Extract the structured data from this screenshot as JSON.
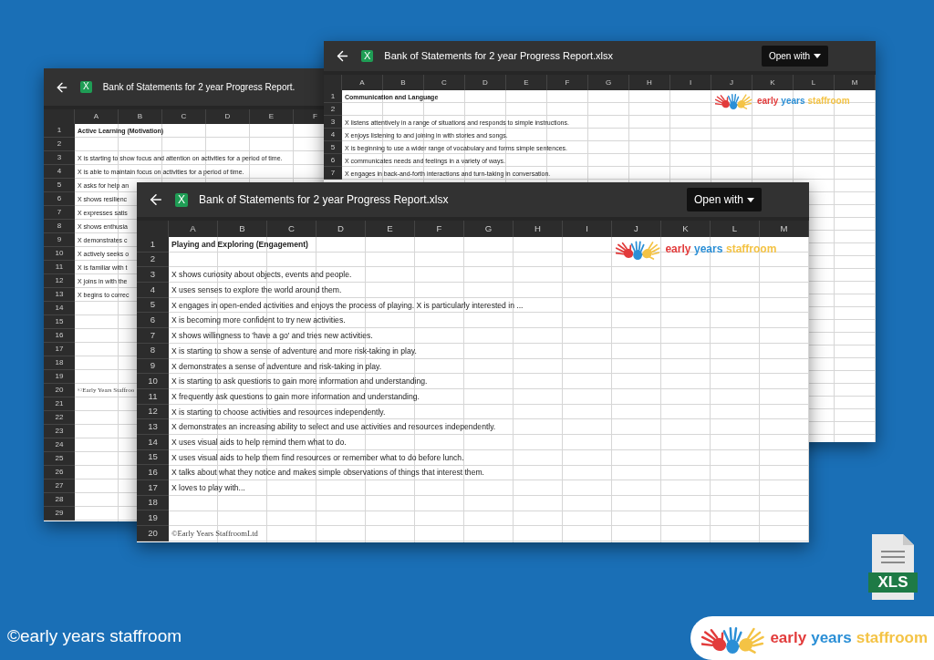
{
  "windows": [
    {
      "title": "Bank of Statements for 2 year Progress Report.xlsx",
      "badge": "X",
      "open_with": "Open with",
      "columns": [
        "A",
        "B",
        "C",
        "D",
        "E",
        "F",
        "G",
        "H",
        "I",
        "J",
        "K",
        "L",
        "M"
      ],
      "logo": {
        "words": [
          {
            "text": "early",
            "color": "#e23b3b"
          },
          {
            "text": "years",
            "color": "#2b8fd6"
          },
          {
            "text": "staffroom",
            "color": "#f4c345"
          }
        ]
      },
      "rows": [
        {
          "number": "1",
          "kind": "heading",
          "text": "Communication and Language"
        },
        {
          "number": "2"
        },
        {
          "number": "3",
          "kind": "statement",
          "text": "X listens attentively in a range of situations and responds to simple instructions."
        },
        {
          "number": "4",
          "kind": "statement",
          "text": "X enjoys listening to and joining in with stories and songs."
        },
        {
          "number": "5",
          "kind": "statement",
          "text": "X is beginning to use a wider range of vocabulary and forms simple sentences."
        },
        {
          "number": "6",
          "kind": "statement",
          "text": "X communicates needs and feelings in a variety of ways."
        },
        {
          "number": "7",
          "kind": "statement",
          "text": "X engages in back-and-forth interactions and turn-taking in conversation."
        }
      ]
    },
    {
      "title": "Bank of Statements for 2 year Progress Report.",
      "badge": "X",
      "columns": [
        "A",
        "B",
        "C",
        "D",
        "E",
        "F"
      ],
      "rows": [
        {
          "number": "1",
          "kind": "heading",
          "text": "Active Learning (Motivation)"
        },
        {
          "number": "2"
        },
        {
          "number": "3",
          "kind": "statement",
          "text": "X is starting to show focus and attention on activities for a period of time."
        },
        {
          "number": "4",
          "kind": "statement",
          "text": "X is able to maintain focus on activities for a period of time."
        },
        {
          "number": "5",
          "kind": "statement",
          "text": "X asks for help an"
        },
        {
          "number": "6",
          "kind": "statement",
          "text": "X shows resilienc"
        },
        {
          "number": "7",
          "kind": "statement",
          "text": "X expresses satis"
        },
        {
          "number": "8",
          "kind": "statement",
          "text": "X shows enthusia"
        },
        {
          "number": "9",
          "kind": "statement",
          "text": "X demonstrates c"
        },
        {
          "number": "10",
          "kind": "statement",
          "text": "X actively seeks o"
        },
        {
          "number": "11",
          "kind": "statement",
          "text": "X is familiar with t"
        },
        {
          "number": "12",
          "kind": "statement",
          "text": "X joins in with the"
        },
        {
          "number": "13",
          "kind": "statement",
          "text": "X begins to correc"
        },
        {
          "number": "14"
        },
        {
          "number": "15"
        },
        {
          "number": "16"
        },
        {
          "number": "17"
        },
        {
          "number": "18"
        },
        {
          "number": "19"
        },
        {
          "number": "20",
          "kind": "copyright",
          "text": "©Early Years Staffroo"
        },
        {
          "number": "21"
        },
        {
          "number": "22"
        },
        {
          "number": "23"
        },
        {
          "number": "24"
        },
        {
          "number": "25"
        },
        {
          "number": "26"
        },
        {
          "number": "27"
        },
        {
          "number": "28"
        },
        {
          "number": "29"
        }
      ]
    },
    {
      "title": "Bank of Statements for 2 year Progress Report.xlsx",
      "badge": "X",
      "open_with": "Open with",
      "columns": [
        "A",
        "B",
        "C",
        "D",
        "E",
        "F",
        "G",
        "H",
        "I",
        "J",
        "K",
        "L",
        "M"
      ],
      "logo": {
        "words": [
          {
            "text": "early",
            "color": "#e23b3b"
          },
          {
            "text": "years",
            "color": "#2b8fd6"
          },
          {
            "text": "staffroom",
            "color": "#f4c345"
          }
        ]
      },
      "rows": [
        {
          "number": "1",
          "kind": "heading",
          "text": "Playing and Exploring (Engagement)"
        },
        {
          "number": "2"
        },
        {
          "number": "3",
          "kind": "statement",
          "text": "X shows curiosity about objects, events and people."
        },
        {
          "number": "4",
          "kind": "statement",
          "text": "X uses senses to explore the world around them."
        },
        {
          "number": "5",
          "kind": "statement",
          "text": "X engages in open-ended activities and enjoys the process of playing. X is particularly interested in ..."
        },
        {
          "number": "6",
          "kind": "statement",
          "text": "X is becoming more confident to try new activities."
        },
        {
          "number": "7",
          "kind": "statement",
          "text": "X shows willingness to 'have a go' and tries new activities."
        },
        {
          "number": "8",
          "kind": "statement",
          "text": "X is starting to show a sense of adventure and more risk-taking in play."
        },
        {
          "number": "9",
          "kind": "statement",
          "text": "X demonstrates a sense of adventure and risk-taking in play."
        },
        {
          "number": "10",
          "kind": "statement",
          "text": "X is starting to ask questions to gain more information and understanding."
        },
        {
          "number": "11",
          "kind": "statement",
          "text": "X frequently ask questions to gain more information and understanding."
        },
        {
          "number": "12",
          "kind": "statement",
          "text": "X is starting to choose activities and resources independently."
        },
        {
          "number": "13",
          "kind": "statement",
          "text": "X demonstrates an increasing ability to select and use activities and resources independently."
        },
        {
          "number": "14",
          "kind": "statement",
          "text": "X uses visual aids to help remind them what to do."
        },
        {
          "number": "15",
          "kind": "statement",
          "text": "X uses visual aids to help them find resources or remember what to do before lunch."
        },
        {
          "number": "16",
          "kind": "statement",
          "text": "X talks about what they notice and makes simple observations of things that interest them."
        },
        {
          "number": "17",
          "kind": "statement",
          "text": "X loves to play with..."
        },
        {
          "number": "18"
        },
        {
          "number": "19"
        },
        {
          "number": "20",
          "kind": "copyright",
          "text": "©Early Years StaffroomLtd"
        }
      ]
    }
  ],
  "file_icon": {
    "label": "XLS"
  },
  "copyright": "©early years staffroom",
  "brand_logo": {
    "words": [
      {
        "text": "early",
        "color": "#e23b3b"
      },
      {
        "text": "years",
        "color": "#2b8fd6"
      },
      {
        "text": "staffroom",
        "color": "#f4c345"
      }
    ]
  }
}
